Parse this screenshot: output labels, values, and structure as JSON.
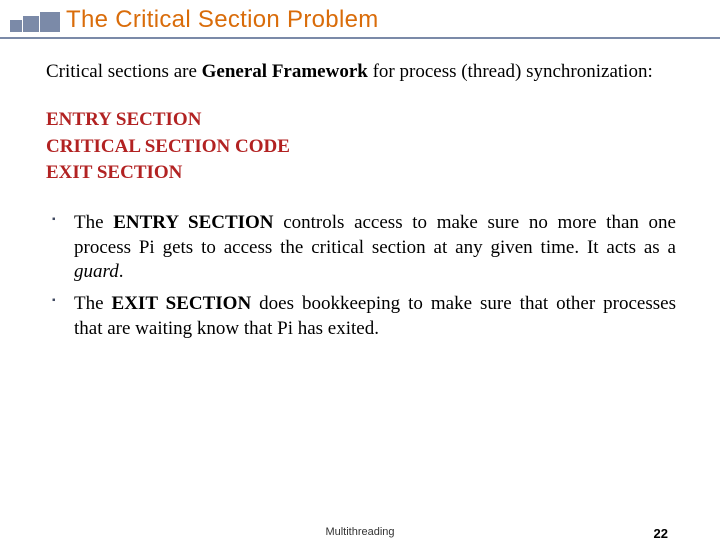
{
  "title": "The Critical Section Problem",
  "intro_prefix": "Critical sections are ",
  "intro_bold": "General Framework",
  "intro_suffix": " for process (thread) synchronization:",
  "red_lines": {
    "l1": "ENTRY SECTION",
    "l2": "CRITICAL SECTION CODE",
    "l3": "EXIT SECTION"
  },
  "bullet1": {
    "p1": "The ",
    "b1": "ENTRY SECTION",
    "p2": " controls access to make sure no more than one process Pi gets to access the critical section at any given time. It acts as a ",
    "i1": "guard",
    "p3": "."
  },
  "bullet2": {
    "p1": "The ",
    "b1": "EXIT SECTION",
    "p2": " does bookkeeping to make sure that other processes that are waiting know that Pi has exited."
  },
  "footer_center": "Multithreading",
  "footer_page": "22"
}
